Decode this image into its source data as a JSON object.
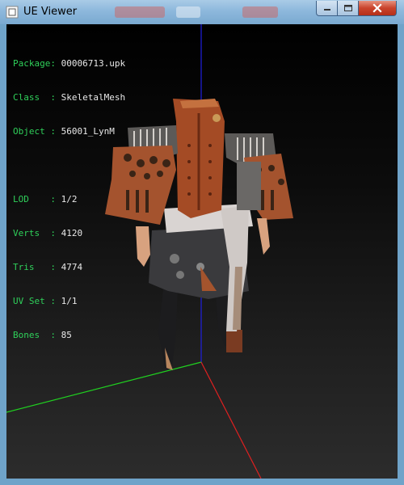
{
  "window": {
    "title": "UE Viewer"
  },
  "info_panel": {
    "group1": [
      {
        "key": "Package",
        "value": "00006713.upk"
      },
      {
        "key": "Class",
        "value": "SkeletalMesh"
      },
      {
        "key": "Object",
        "value": "56001_LynM"
      }
    ],
    "group2": [
      {
        "key": "LOD",
        "value": "1/2"
      },
      {
        "key": "Verts",
        "value": "4120"
      },
      {
        "key": "Tris",
        "value": "4774"
      },
      {
        "key": "UV Set",
        "value": "1/1"
      },
      {
        "key": "Bones",
        "value": "85"
      }
    ]
  },
  "colors": {
    "label_green": "#2fd05a",
    "value_white": "#e8e8e8",
    "axis_x": "#e02020",
    "axis_y": "#20d020",
    "axis_z": "#2020e0"
  },
  "icons": {
    "app": "ue-viewer-icon",
    "minimize": "minimize-icon",
    "maximize": "maximize-icon",
    "close": "close-icon"
  }
}
